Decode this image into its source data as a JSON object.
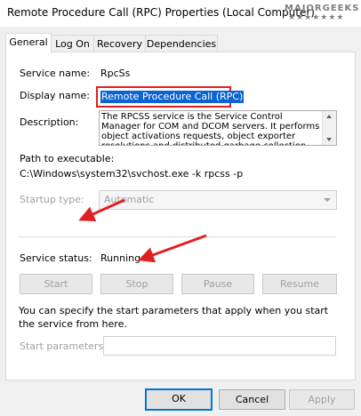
{
  "window": {
    "title": "Remote Procedure Call (RPC) Properties (Local Computer)",
    "watermark": "MAJORGEEKS",
    "watermark_stars": "★★★★★★★"
  },
  "tabs": [
    {
      "label": "General",
      "active": true
    },
    {
      "label": "Log On"
    },
    {
      "label": "Recovery"
    },
    {
      "label": "Dependencies"
    }
  ],
  "general": {
    "service_name_label": "Service name:",
    "service_name_value": "RpcSs",
    "display_name_label": "Display name:",
    "display_name_value": "Remote Procedure Call (RPC)",
    "description_label": "Description:",
    "description_value": "The RPCSS service is the Service Control Manager for COM and DCOM servers. It performs object activations requests, object exporter resolutions and distributed garbage collection for COM and DCOM servers.",
    "path_label": "Path to executable:",
    "path_value": "C:\\Windows\\system32\\svchost.exe -k rpcss -p",
    "startup_type_label": "Startup type:",
    "startup_type_value": "Automatic",
    "service_status_label": "Service status:",
    "service_status_value": "Running",
    "buttons": {
      "start": "Start",
      "stop": "Stop",
      "pause": "Pause",
      "resume": "Resume"
    },
    "hint": "You can specify the start parameters that apply when you start the service from here.",
    "start_params_label": "Start parameters:",
    "start_params_value": ""
  },
  "footer": {
    "ok": "OK",
    "cancel": "Cancel",
    "apply": "Apply"
  },
  "colors": {
    "highlight_box": "#e02020",
    "arrow": "#e02020",
    "selection": "#0a64d2",
    "ok_border": "#0078d7"
  }
}
